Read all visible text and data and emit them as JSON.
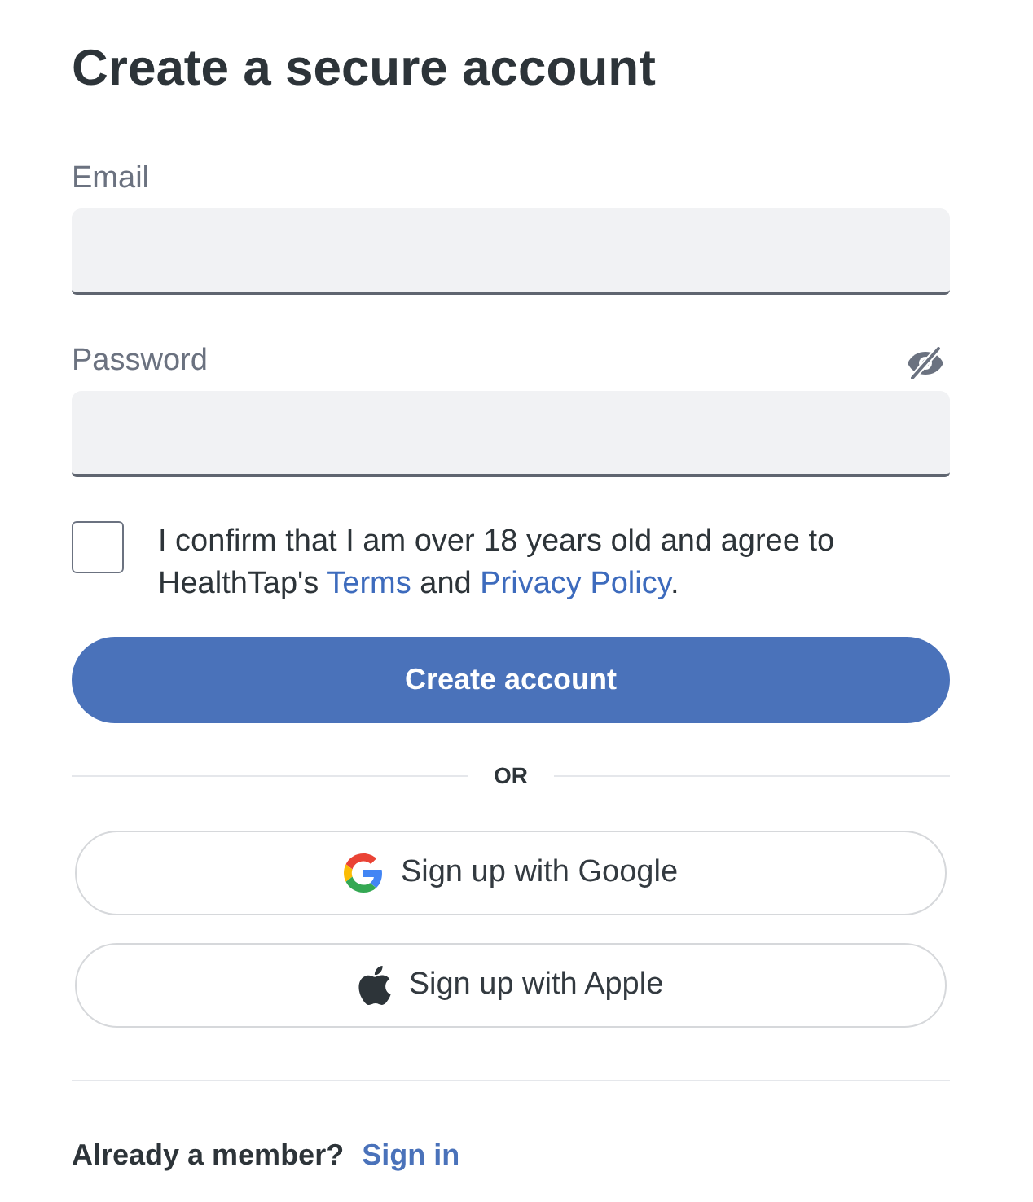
{
  "title": "Create a secure account",
  "fields": [
    {
      "label": "Email",
      "reveal_toggle": false
    },
    {
      "label": "Password",
      "reveal_toggle": true
    }
  ],
  "consent": {
    "checked": false,
    "parts": [
      {
        "kind": "text",
        "text": "I confirm that I am over 18 years old and agree to HealthTap's "
      },
      {
        "kind": "link",
        "text": "Terms"
      },
      {
        "kind": "text",
        "text": " and "
      },
      {
        "kind": "link",
        "text": "Privacy Policy"
      },
      {
        "kind": "text",
        "text": "."
      }
    ]
  },
  "primary_button": {
    "label": "Create account"
  },
  "divider_text": "OR",
  "social_buttons": [
    {
      "kind": "google",
      "label": "Sign up with Google"
    },
    {
      "kind": "apple",
      "label": "Sign up with Apple"
    }
  ],
  "footer": {
    "prompt": "Already a member?",
    "link": "Sign in"
  }
}
